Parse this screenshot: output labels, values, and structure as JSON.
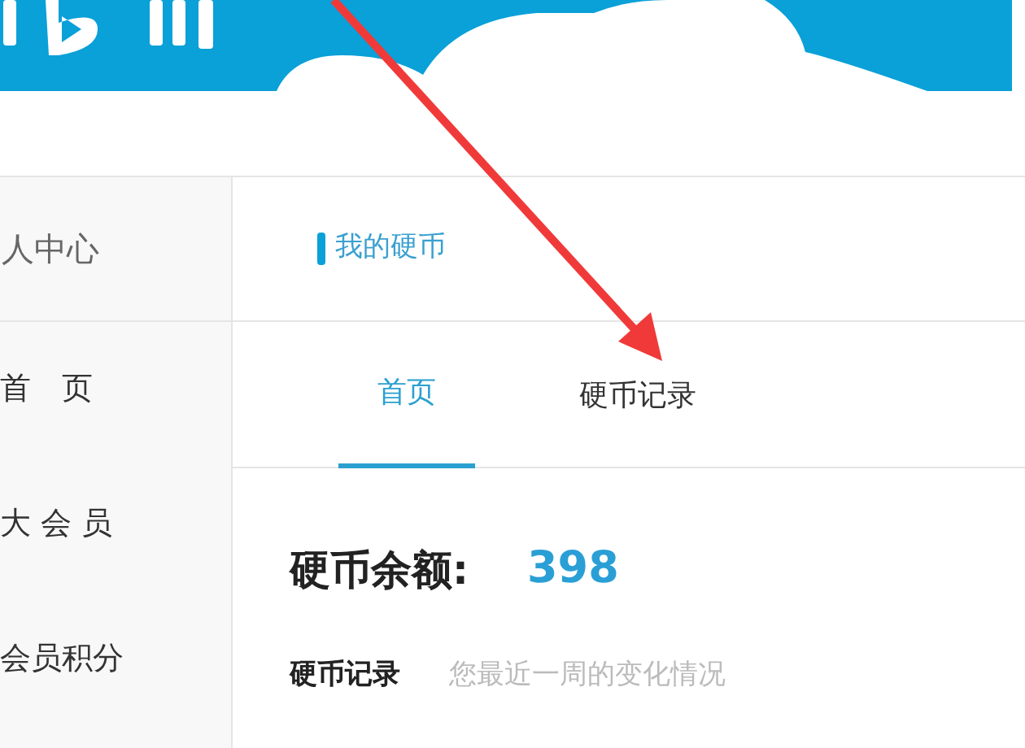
{
  "sidebar": {
    "title": "人中心",
    "items": [
      {
        "label": "首　页",
        "selected": false
      },
      {
        "label": "大 会 员",
        "selected": false
      },
      {
        "label": "会员积分",
        "selected": false
      }
    ]
  },
  "section_title": "我的硬币",
  "tabs": [
    {
      "label": "首页",
      "selected": true
    },
    {
      "label": "硬币记录",
      "selected": false
    }
  ],
  "balance": {
    "label": "硬币余额:",
    "value": "398"
  },
  "records": {
    "title": "硬币记录",
    "hint": "您最近一周的变化情况"
  }
}
